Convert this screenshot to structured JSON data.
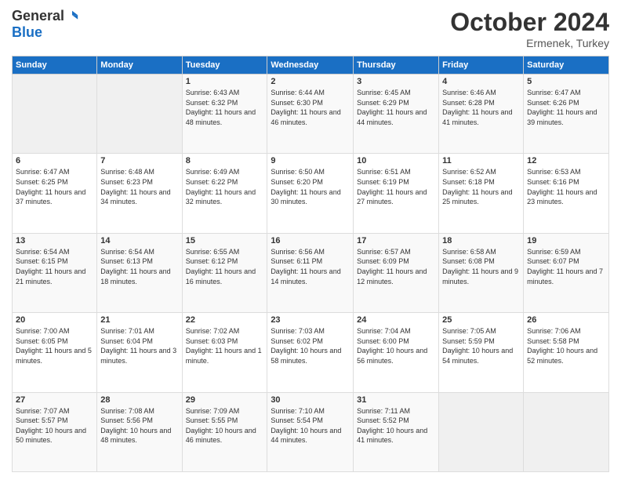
{
  "header": {
    "logo_general": "General",
    "logo_blue": "Blue",
    "month_title": "October 2024",
    "location": "Ermenek, Turkey"
  },
  "weekdays": [
    "Sunday",
    "Monday",
    "Tuesday",
    "Wednesday",
    "Thursday",
    "Friday",
    "Saturday"
  ],
  "weeks": [
    [
      null,
      null,
      {
        "day": 1,
        "sunrise": "6:43 AM",
        "sunset": "6:32 PM",
        "daylight": "11 hours and 48 minutes."
      },
      {
        "day": 2,
        "sunrise": "6:44 AM",
        "sunset": "6:30 PM",
        "daylight": "11 hours and 46 minutes."
      },
      {
        "day": 3,
        "sunrise": "6:45 AM",
        "sunset": "6:29 PM",
        "daylight": "11 hours and 44 minutes."
      },
      {
        "day": 4,
        "sunrise": "6:46 AM",
        "sunset": "6:28 PM",
        "daylight": "11 hours and 41 minutes."
      },
      {
        "day": 5,
        "sunrise": "6:47 AM",
        "sunset": "6:26 PM",
        "daylight": "11 hours and 39 minutes."
      }
    ],
    [
      {
        "day": 6,
        "sunrise": "6:47 AM",
        "sunset": "6:25 PM",
        "daylight": "11 hours and 37 minutes."
      },
      {
        "day": 7,
        "sunrise": "6:48 AM",
        "sunset": "6:23 PM",
        "daylight": "11 hours and 34 minutes."
      },
      {
        "day": 8,
        "sunrise": "6:49 AM",
        "sunset": "6:22 PM",
        "daylight": "11 hours and 32 minutes."
      },
      {
        "day": 9,
        "sunrise": "6:50 AM",
        "sunset": "6:20 PM",
        "daylight": "11 hours and 30 minutes."
      },
      {
        "day": 10,
        "sunrise": "6:51 AM",
        "sunset": "6:19 PM",
        "daylight": "11 hours and 27 minutes."
      },
      {
        "day": 11,
        "sunrise": "6:52 AM",
        "sunset": "6:18 PM",
        "daylight": "11 hours and 25 minutes."
      },
      {
        "day": 12,
        "sunrise": "6:53 AM",
        "sunset": "6:16 PM",
        "daylight": "11 hours and 23 minutes."
      }
    ],
    [
      {
        "day": 13,
        "sunrise": "6:54 AM",
        "sunset": "6:15 PM",
        "daylight": "11 hours and 21 minutes."
      },
      {
        "day": 14,
        "sunrise": "6:54 AM",
        "sunset": "6:13 PM",
        "daylight": "11 hours and 18 minutes."
      },
      {
        "day": 15,
        "sunrise": "6:55 AM",
        "sunset": "6:12 PM",
        "daylight": "11 hours and 16 minutes."
      },
      {
        "day": 16,
        "sunrise": "6:56 AM",
        "sunset": "6:11 PM",
        "daylight": "11 hours and 14 minutes."
      },
      {
        "day": 17,
        "sunrise": "6:57 AM",
        "sunset": "6:09 PM",
        "daylight": "11 hours and 12 minutes."
      },
      {
        "day": 18,
        "sunrise": "6:58 AM",
        "sunset": "6:08 PM",
        "daylight": "11 hours and 9 minutes."
      },
      {
        "day": 19,
        "sunrise": "6:59 AM",
        "sunset": "6:07 PM",
        "daylight": "11 hours and 7 minutes."
      }
    ],
    [
      {
        "day": 20,
        "sunrise": "7:00 AM",
        "sunset": "6:05 PM",
        "daylight": "11 hours and 5 minutes."
      },
      {
        "day": 21,
        "sunrise": "7:01 AM",
        "sunset": "6:04 PM",
        "daylight": "11 hours and 3 minutes."
      },
      {
        "day": 22,
        "sunrise": "7:02 AM",
        "sunset": "6:03 PM",
        "daylight": "11 hours and 1 minute."
      },
      {
        "day": 23,
        "sunrise": "7:03 AM",
        "sunset": "6:02 PM",
        "daylight": "10 hours and 58 minutes."
      },
      {
        "day": 24,
        "sunrise": "7:04 AM",
        "sunset": "6:00 PM",
        "daylight": "10 hours and 56 minutes."
      },
      {
        "day": 25,
        "sunrise": "7:05 AM",
        "sunset": "5:59 PM",
        "daylight": "10 hours and 54 minutes."
      },
      {
        "day": 26,
        "sunrise": "7:06 AM",
        "sunset": "5:58 PM",
        "daylight": "10 hours and 52 minutes."
      }
    ],
    [
      {
        "day": 27,
        "sunrise": "7:07 AM",
        "sunset": "5:57 PM",
        "daylight": "10 hours and 50 minutes."
      },
      {
        "day": 28,
        "sunrise": "7:08 AM",
        "sunset": "5:56 PM",
        "daylight": "10 hours and 48 minutes."
      },
      {
        "day": 29,
        "sunrise": "7:09 AM",
        "sunset": "5:55 PM",
        "daylight": "10 hours and 46 minutes."
      },
      {
        "day": 30,
        "sunrise": "7:10 AM",
        "sunset": "5:54 PM",
        "daylight": "10 hours and 44 minutes."
      },
      {
        "day": 31,
        "sunrise": "7:11 AM",
        "sunset": "5:52 PM",
        "daylight": "10 hours and 41 minutes."
      },
      null,
      null
    ]
  ]
}
